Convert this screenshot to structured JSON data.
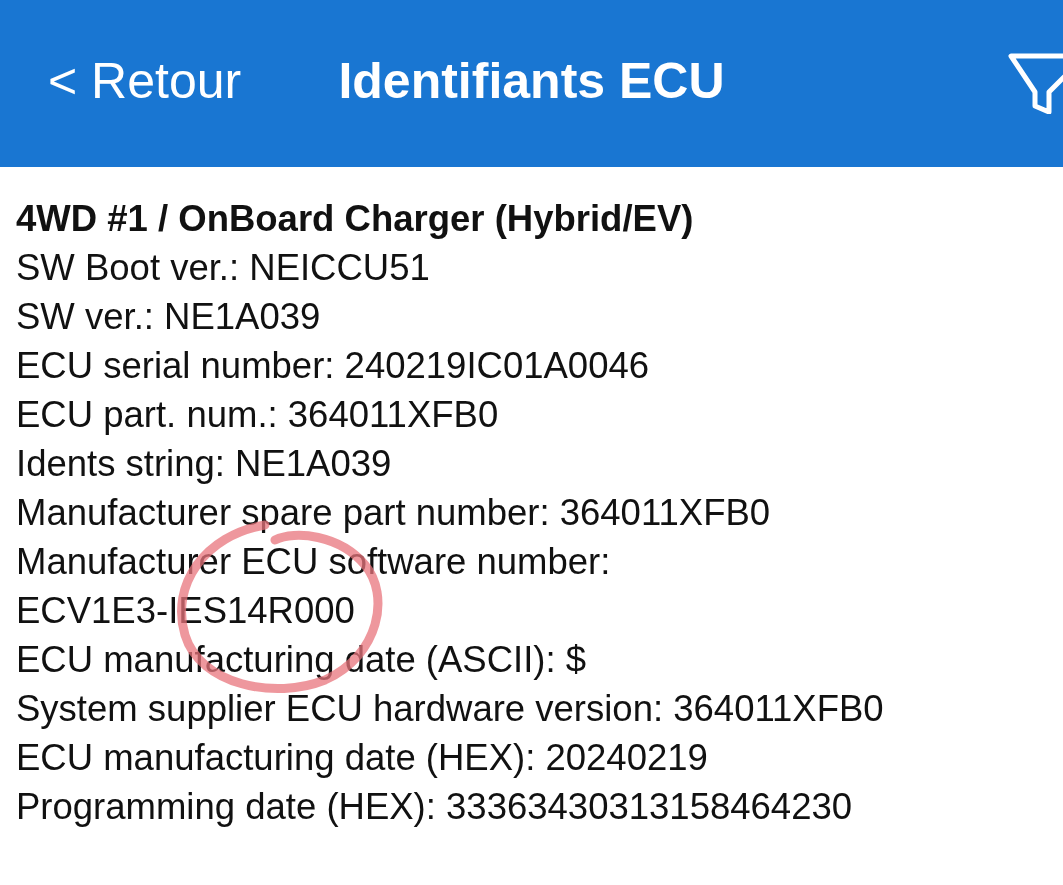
{
  "header": {
    "back": "< Retour",
    "title": "Identifiants ECU"
  },
  "ecu": {
    "name": "4WD #1 / OnBoard Charger (Hybrid/EV)",
    "lines": [
      "SW Boot ver.: NEICCU51",
      "SW ver.: NE1A039",
      "ECU serial number: 240219IC01A0046",
      "ECU part. num.: 364011XFB0",
      "Idents string: NE1A039",
      "Manufacturer spare part number: 364011XFB0",
      "Manufacturer ECU software number:",
      "ECV1E3-IES14R000",
      "ECU manufacturing date (ASCII): $",
      "System supplier ECU hardware version: 364011XFB0",
      "ECU manufacturing date (HEX): 20240219",
      "Programming date (HEX): 33363430313158464230"
    ]
  },
  "annotation": {
    "kind": "circle"
  }
}
